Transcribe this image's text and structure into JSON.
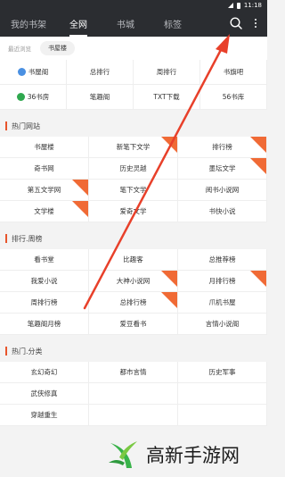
{
  "status": {
    "time": "11:18"
  },
  "tabs": [
    "我的书架",
    "全网",
    "书城",
    "标签"
  ],
  "recent": {
    "label": "最近浏览",
    "chip": "书屋楼"
  },
  "top_grid": [
    {
      "label": "书屋阁",
      "icon": "globe-icon",
      "icon_color": "#4a90e2"
    },
    {
      "label": "总排行"
    },
    {
      "label": "周排行"
    },
    {
      "label": "书旗吧"
    },
    {
      "label": "36书房",
      "icon": "book-logo-icon",
      "icon_color": "#2fa84f"
    },
    {
      "label": "笔趣阁"
    },
    {
      "label": "TXT下载"
    },
    {
      "label": "56书库"
    }
  ],
  "sections": [
    {
      "title": "热门网站",
      "cells": [
        {
          "label": "书屋楼",
          "badge": false
        },
        {
          "label": "新笔下文学",
          "badge": true
        },
        {
          "label": "排行榜",
          "badge": true
        },
        {
          "label": "奇书网",
          "badge": false
        },
        {
          "label": "历史灵越",
          "badge": false
        },
        {
          "label": "墨坛文学",
          "badge": true
        },
        {
          "label": "第五文学网",
          "badge": true
        },
        {
          "label": "笔下文学",
          "badge": false
        },
        {
          "label": "阅书小说网",
          "badge": false
        },
        {
          "label": "文学楼",
          "badge": true
        },
        {
          "label": "爱奇文学",
          "badge": false
        },
        {
          "label": "书快小说",
          "badge": false
        }
      ]
    },
    {
      "title": "排行.周榜",
      "cells": [
        {
          "label": "看书堂",
          "badge": false
        },
        {
          "label": "比趣客",
          "badge": false
        },
        {
          "label": "总推荐榜",
          "badge": false
        },
        {
          "label": "我爱小说",
          "badge": false
        },
        {
          "label": "大神小说网",
          "badge": true
        },
        {
          "label": "月排行榜",
          "badge": true
        },
        {
          "label": "周排行榜",
          "badge": false
        },
        {
          "label": "总排行榜",
          "badge": true
        },
        {
          "label": "爪机书屋",
          "badge": false
        },
        {
          "label": "笔趣阁月榜",
          "badge": false
        },
        {
          "label": "爱豆看书",
          "badge": false
        },
        {
          "label": "言情小说阁",
          "badge": false
        }
      ]
    },
    {
      "title": "热门.分类",
      "cells": [
        {
          "label": "玄幻奇幻",
          "badge": false
        },
        {
          "label": "都市言情",
          "badge": false
        },
        {
          "label": "历史军事",
          "badge": false
        },
        {
          "label": "武侠修真",
          "badge": false
        },
        {
          "label": "",
          "badge": false
        },
        {
          "label": "",
          "badge": false
        },
        {
          "label": "穿越重生",
          "badge": false
        },
        {
          "label": "",
          "badge": false
        },
        {
          "label": "",
          "badge": false
        }
      ]
    }
  ],
  "watermark": {
    "text": "高新手游网"
  },
  "colors": {
    "accent": "#e8542b",
    "badge": "#f06a35",
    "arrow": "#e8402a",
    "topbar": "#2b2d31"
  }
}
